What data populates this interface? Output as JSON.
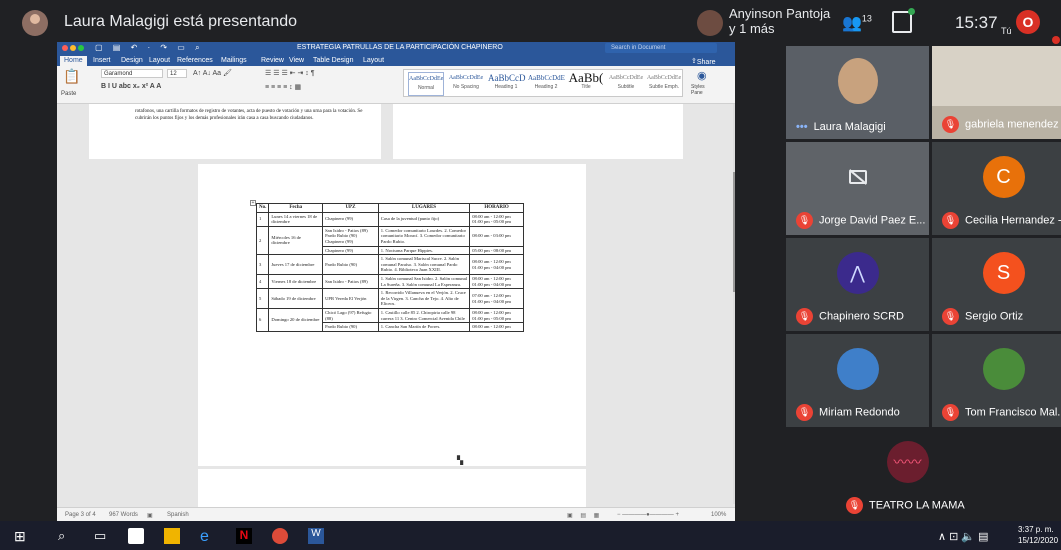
{
  "meet": {
    "presenting_label": "Laura Malagigi está presentando",
    "pinned_name_line1": "Anyinson Pantoja",
    "pinned_name_line2": "y 1 más",
    "participants_count": "13",
    "clock": "15:37",
    "self_initial": "O",
    "self_label": "Tú",
    "participants_icon": "people-icon",
    "chat_icon": "chat-icon"
  },
  "word": {
    "window_title": "ESTRATEGIA PATRULLAS DE LA PARTICIPACIÓN CHAPINERO",
    "search_placeholder": "Search in Document",
    "tabs": [
      "Home",
      "Insert",
      "Design",
      "Layout",
      "References",
      "Mailings",
      "Review",
      "View",
      "Table Design",
      "Layout"
    ],
    "share_label": "Share",
    "paste_label": "Paste",
    "font_name": "Garamond",
    "font_size": "12",
    "styles": [
      {
        "preview": "AaBbCcDdEe",
        "name": "Normal"
      },
      {
        "preview": "AaBbCcDdEe",
        "name": "No Spacing"
      },
      {
        "preview": "AaBbCcD",
        "name": "Heading 1"
      },
      {
        "preview": "AaBbCcDdE",
        "name": "Heading 2"
      },
      {
        "preview": "AaBb(",
        "name": "Title"
      },
      {
        "preview": "AaBbCcDdEe",
        "name": "Subtitle"
      },
      {
        "preview": "AaBbCcDdEe",
        "name": "Subtle Emph."
      }
    ],
    "styles_pane_label": "Styles Pane",
    "top_paragraph": "rotafonos, una cartilla formatos de registro de votantes, acta de puesto de votación y una urna para la votación. Se cubrirán los puntos fijos y los demás profesionales irán casa a casa buscando ciudadanos.",
    "status": {
      "page": "Page 3 of 4",
      "words": "967 Words",
      "language": "Spanish",
      "zoom": "100%"
    },
    "table": {
      "headers": [
        "No.",
        "Fecha",
        "UPZ",
        "LUGARES",
        "HORARIO"
      ],
      "rows": [
        {
          "no": "1",
          "fecha": "Lunes 14 a viernes 18 de diciembre",
          "upz": "Chapinero (99)",
          "lugares": "Casa de la juventud (punto fijo)",
          "horario": "08:00 am - 12:00 pm 01:00 pm - 05:00 pm"
        },
        {
          "no": "2",
          "fecha": "Miércoles 16 de diciembre",
          "upz": "San Isidro - Patios (89) Pardo Rubio (90) Chapinero (99)",
          "lugares": "1. Comedor comunitario Lourdes. 2. Comedor comunitario Morací. 3. Comedor comunitario Pardo Rubio.",
          "horario": "08:00 am - 03:00 pm"
        },
        {
          "no": "",
          "fecha": "",
          "upz": "Chapinero (99)",
          "lugares": "1. Nocturna Parque Hippies.",
          "horario": "05:00 pm - 08:00 pm"
        },
        {
          "no": "3",
          "fecha": "Jueves 17 de diciembre",
          "upz": "Pardo Rubio (90)",
          "lugares": "1. Salón comunal Mariscal Sucre. 2. Salón comunal Paraíso. 3. Salón comunal Pardo Rubio. 4. Biblioteca Juan XXIII.",
          "horario": "08:00 am - 12:00 pm 01:00 pm - 04:00 pm"
        },
        {
          "no": "4",
          "fecha": "Viernes 18 de diciembre",
          "upz": "San Isidro - Patios (89)",
          "lugares": "1. Salón comunal San Isidro. 2. Salón comunal La Sureña. 3. Salón comunal La Esperanza.",
          "horario": "08:00 am - 12:00 pm 01:00 pm - 04:00 pm"
        },
        {
          "no": "5",
          "fecha": "Sábado 19 de diciembre",
          "upz": "UPR Vereda El Verjón",
          "lugares": "1. Recorrido Villanueva en el Verjón. 2. Cruce de la Virgen. 3. Cancha de Tejo. 4. Alto de Eliceos.",
          "horario": "07:00 am - 12:00 pm 01:00 pm - 04:00 pm"
        },
        {
          "no": "6",
          "fecha": "Domingo 20 de diciembre",
          "upz": "Chicó Lago (97) Refugio (88)",
          "lugares": "1. Castillo calle 85 2. Chiropiria calle 98 carrera 11 3. Centro Comercial Avenida Chile",
          "horario": "08:00 am - 12:00 pm 01:00 pm - 05:00 pm"
        },
        {
          "no": "",
          "fecha": "",
          "upz": "Pardo Rubio (90)",
          "lugares": "1. Cancha San Martín de Porres.",
          "horario": "08:00 am - 12:00 pm"
        }
      ]
    }
  },
  "tiles": [
    {
      "name": "Laura Malagigi",
      "kind": "video-self",
      "muted": false
    },
    {
      "name": "gabriela menendez",
      "kind": "video",
      "muted": true
    },
    {
      "name": "Jorge David Paez E...",
      "kind": "camoff",
      "muted": true
    },
    {
      "name": "Cecilia Hernandez -...",
      "kind": "initial",
      "initial": "C",
      "color": "#e8710a",
      "muted": true
    },
    {
      "name": "Chapinero SCRD",
      "kind": "logo",
      "muted": true
    },
    {
      "name": "Sergio Ortiz",
      "kind": "initial",
      "initial": "S",
      "color": "#f4511e",
      "muted": true
    },
    {
      "name": "Miriam Redondo",
      "kind": "photo",
      "muted": true
    },
    {
      "name": "Tom Francisco Mal...",
      "kind": "photo",
      "muted": true
    },
    {
      "name": "TEATRO LA MAMA",
      "kind": "audio",
      "muted": true
    }
  ],
  "taskbar": {
    "time": "3:37 p. m.",
    "date": "15/12/2020"
  }
}
